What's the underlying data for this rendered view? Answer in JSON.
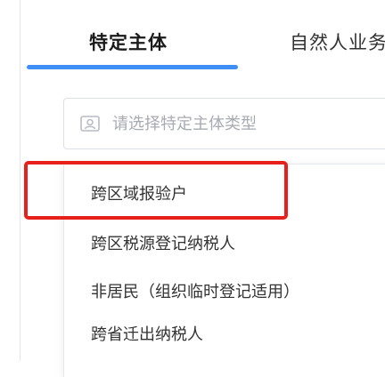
{
  "tabs": [
    {
      "label": "特定主体",
      "active": true
    },
    {
      "label": "自然人业务",
      "active": false
    }
  ],
  "colors": {
    "tab_accent": "#3f8ef5",
    "highlight": "#e8201c",
    "placeholder": "#a8abb2"
  },
  "select": {
    "icon": "id-card-icon",
    "placeholder": "请选择特定主体类型"
  },
  "dropdown": {
    "options": [
      {
        "label": "跨区域报验户"
      },
      {
        "label": "跨区税源登记纳税人"
      },
      {
        "label": "非居民（组织临时登记适用）"
      },
      {
        "label": "跨省迁出纳税人"
      }
    ]
  }
}
